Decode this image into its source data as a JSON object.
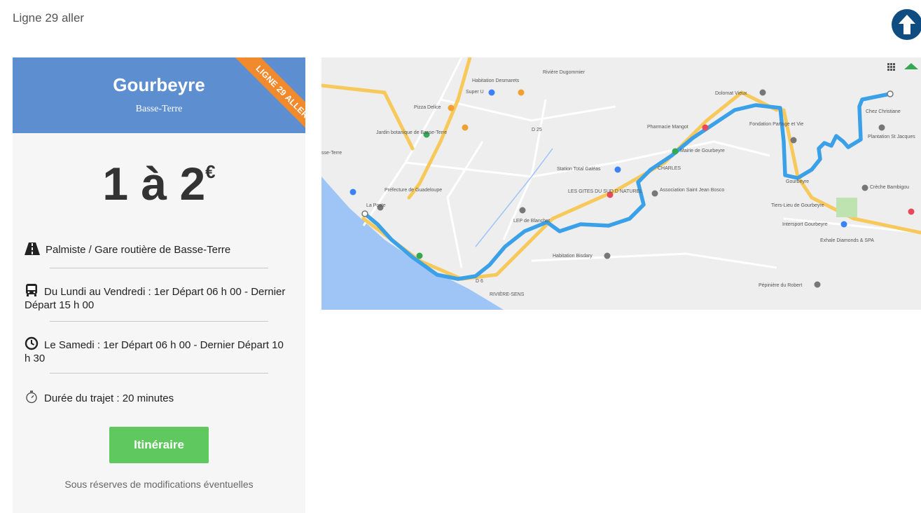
{
  "header": {
    "breadcrumb": "Ligne 29  aller"
  },
  "card": {
    "title": "Gourbeyre",
    "subtitle": "Basse-Terre",
    "ribbon": "LIGNE 29 ALLER",
    "price": "1 à 2",
    "price_unit": "€",
    "start_point": "Palmiste / Gare routière de Basse-Terre",
    "weekday_schedule": "Du Lundi au Vendredi : 1er Départ 06 h 00 - Dernier Départ 15 h 00",
    "saturday_schedule": "Le Samedi : 1er Départ 06 h 00 - Dernier Départ 10 h 30",
    "duration": "Durée du trajet : 20 minutes",
    "itinerary_button": "Itinéraire",
    "disclaimer": "Sous réserves de modifications éventuelles"
  },
  "map": {
    "labels": {
      "habitation_desmarets": "Habitation Desmarets",
      "riviere_dugommier": "Rivière Dugommier",
      "super_u": "Super U",
      "pizza": "Pizza Delice",
      "jardin": "Jardin botanique de Basse-Terre",
      "basse_terre": "sse-Terre",
      "prefecture": "Préfecture de Guadeloupe",
      "la_poste": "La Poste",
      "station_total": "Station Total Galéas",
      "pharmacie": "Pharmacie Mangot",
      "gites": "LES GITES DU SUD D NATUREL",
      "charles": "CHARLES",
      "association": "Association Saint Jean Bosco",
      "mairie": "Mairie de Gourbeyre",
      "gourbeyre": "Gourbeyre",
      "tiers_lieu": "Tiers-Lieu de Gourbeyre",
      "intersport": "Intersport Gourbeyre",
      "creche": "Crèche Bambigou",
      "plantation": "Plantation St Jacques",
      "chez": "Chez Christiane",
      "fondation": "Fondation Partage et Vie",
      "exhale": "Exhale Diamonds & SPA",
      "pepiniere": "Pépinière du Robert",
      "riviere_sens": "RIVIÈRE-SENS",
      "habitation_bisdary": "Habitation Bisdary",
      "lep": "LEP de Blanchet",
      "d25": "D 25",
      "d6": "D 6",
      "dolomat": "Dolomat Vieux"
    },
    "colors": {
      "route": "#3aa0e8",
      "sea": "#9ec5f5",
      "road": "#f6c95a",
      "land": "#eeeeee",
      "accent_orange": "#f08a2c",
      "header_blue": "#5d8fd0",
      "button_green": "#5fc95f"
    }
  }
}
